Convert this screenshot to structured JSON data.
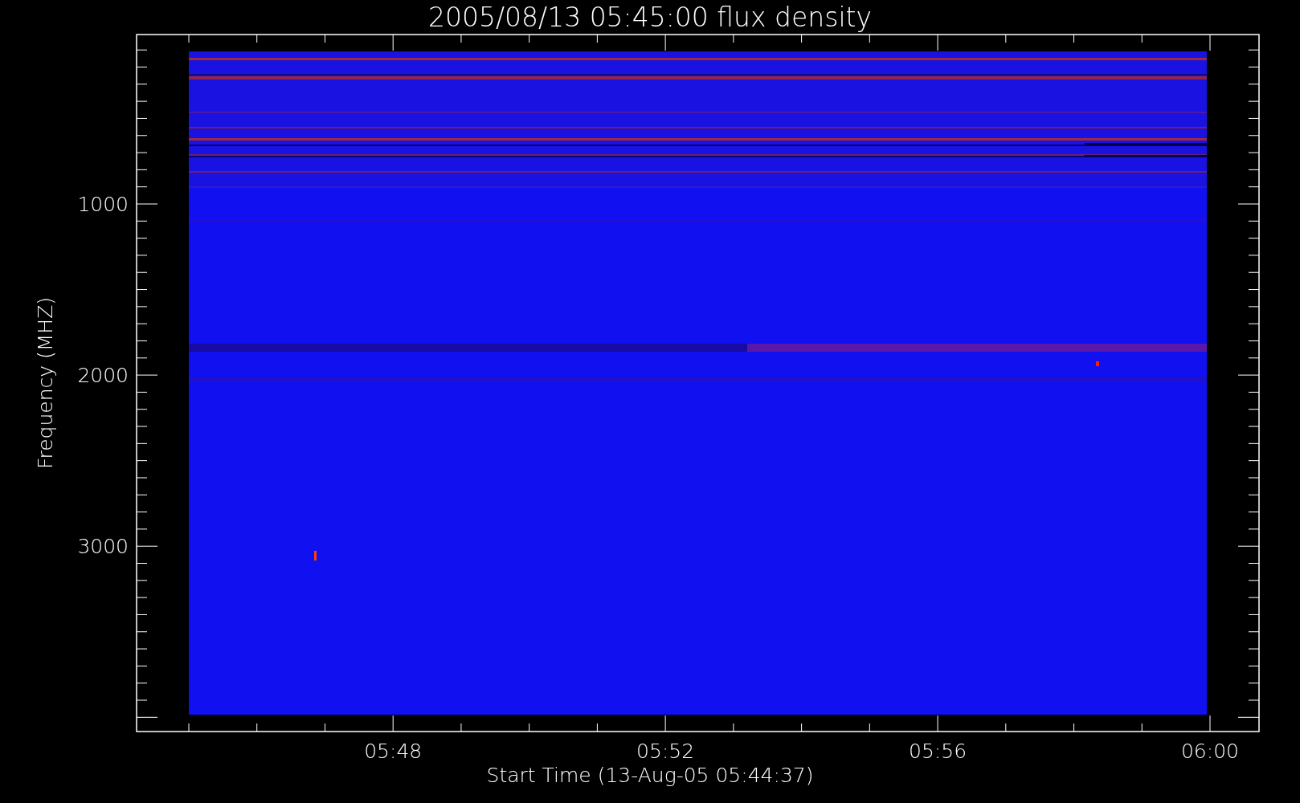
{
  "title": "2005/08/13 05:45:00 flux density",
  "x_axis": {
    "label": "Start Time (13-Aug-05 05:44:37)",
    "ticks": [
      "05:48",
      "05:52",
      "05:56",
      "06:00"
    ]
  },
  "y_axis": {
    "label": "Frequency (MHZ)",
    "ticks": [
      "1000",
      "2000",
      "3000"
    ]
  }
}
